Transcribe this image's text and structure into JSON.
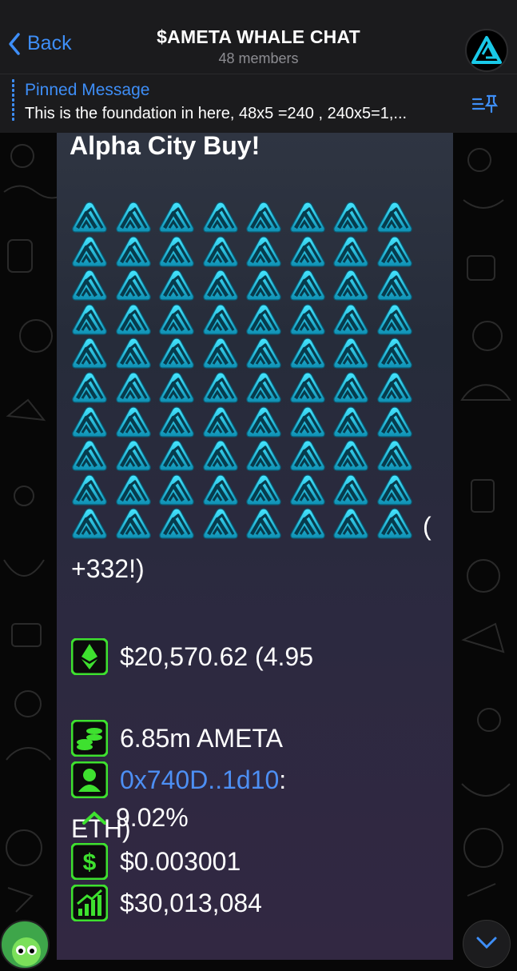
{
  "header": {
    "back_label": "Back",
    "title": "$AMETA WHALE CHAT",
    "members": "48 members"
  },
  "pinned": {
    "title": "Pinned Message",
    "text": "This is the foundation in here, 48x5 =240 , 240x5=1,..."
  },
  "message": {
    "title": "Alpha City Buy!",
    "emoji_rows": 10,
    "emoji_cols": 8,
    "emoji_icon": "ameta-logo-icon",
    "paren_open": "(",
    "bonus": "+332!)",
    "usd_value": "$20,570.62 (4.95",
    "eth_cont": "ETH)",
    "tokens": "6.85m AMETA",
    "buyer": "0x740D..1d10",
    "buyer_suffix": ":",
    "pct": "9.02%",
    "price": "$0.003001",
    "market_cap": "$30,013,084"
  },
  "colors": {
    "accent": "#3e8ef7",
    "logo": "#19c9e8",
    "green_icon": "#3ee12f",
    "link": "#4d8ff4"
  }
}
